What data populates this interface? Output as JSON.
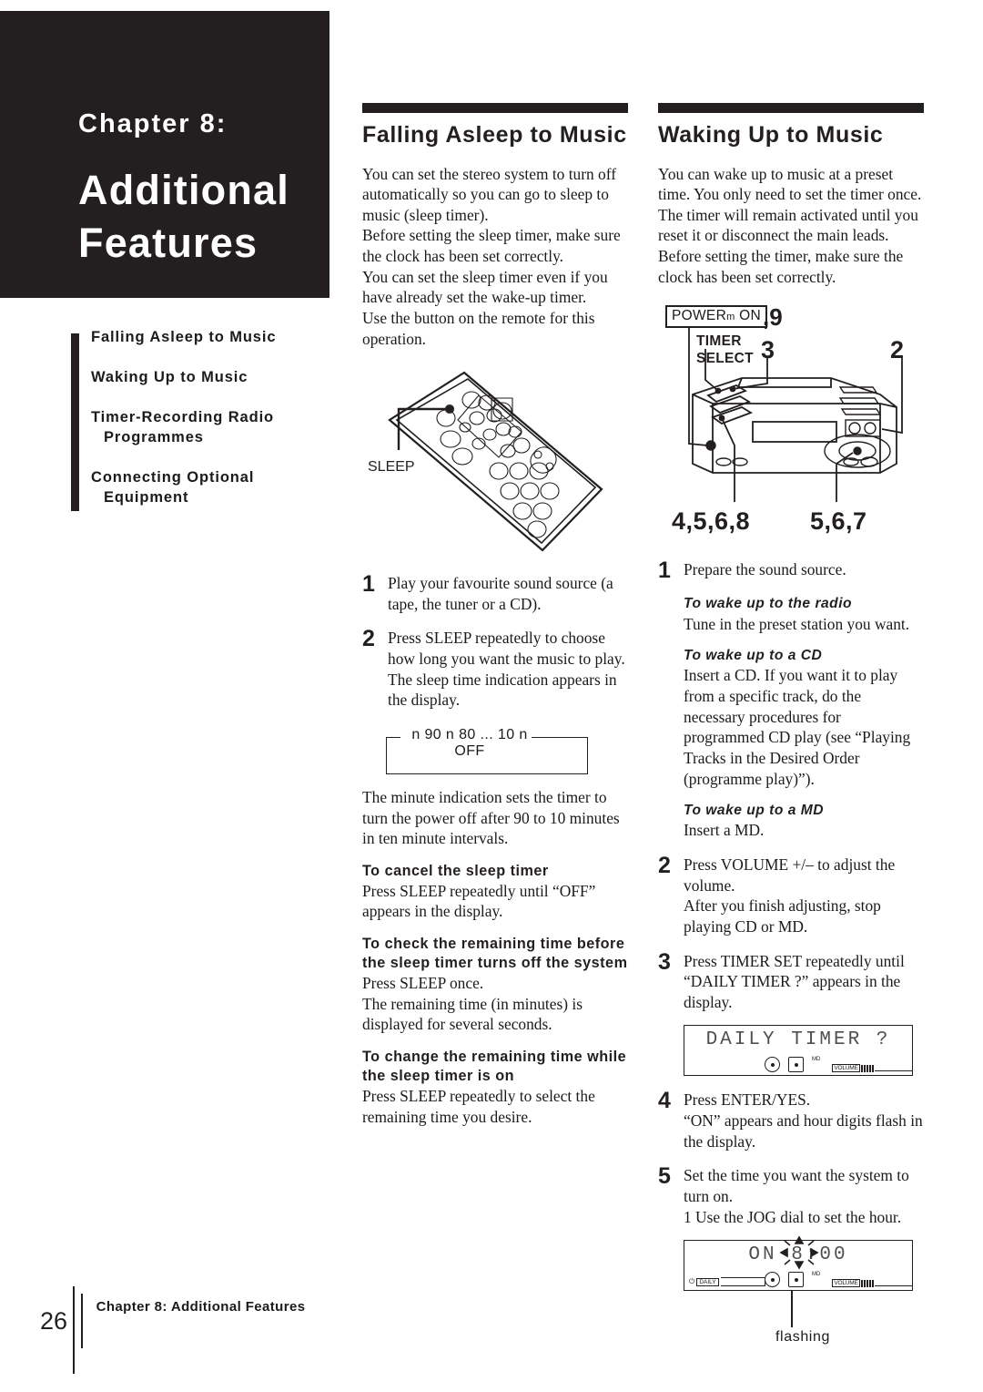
{
  "chapter": {
    "kicker": "Chapter 8:",
    "title": "Additional Features"
  },
  "toc": {
    "items": [
      {
        "line1": "Falling Asleep to Music",
        "line2": ""
      },
      {
        "line1": "Waking Up to Music",
        "line2": ""
      },
      {
        "line1": "Timer-Recording Radio",
        "line2": "Programmes"
      },
      {
        "line1": "Connecting Optional",
        "line2": "Equipment"
      }
    ]
  },
  "middle": {
    "heading": "Falling Asleep to Music",
    "intro": [
      "You can set the stereo system to turn off automatically so you can go to sleep to music (sleep timer).",
      "Before setting the sleep timer, make sure the clock has been set correctly.",
      "You can set the sleep timer even if you have already set the wake-up timer.",
      "Use the button on the remote for this operation."
    ],
    "remote_label": "SLEEP",
    "steps": [
      {
        "num": "1",
        "text": "Play your favourite sound source (a tape, the tuner or a CD)."
      },
      {
        "num": "2",
        "text": "Press SLEEP repeatedly to choose how long you want the music to play."
      }
    ],
    "step2_extra": "The sleep time indication appears in the display.",
    "cycle_text": "n 90 n 80 ... 10 n OFF",
    "after_cycle": "The minute indication sets the timer to turn the power off after 90 to 10 minutes in ten minute intervals.",
    "sections": [
      {
        "heading": "To cancel the sleep timer",
        "body": "Press SLEEP repeatedly until “OFF” appears in  the display."
      },
      {
        "heading": "To check the remaining time before the sleep timer turns off the system",
        "body": "Press SLEEP once.\nThe remaining time (in minutes) is displayed for several seconds."
      },
      {
        "heading": "To change the remaining time while the sleep timer is on",
        "body": "Press SLEEP repeatedly to select the remaining time you desire."
      }
    ]
  },
  "right": {
    "heading": "Waking Up to Music",
    "intro": [
      "You can wake up to music at a preset time. You only need to set the timer once. The timer will remain activated until you reset it or disconnect the main leads.",
      "Before setting the timer, make sure the clock has been set correctly."
    ],
    "diagram": {
      "power_label": "POWER",
      "power_mark": "m",
      "power_on": "ON",
      "power_steps": ",9",
      "timer_select": "TIMER\nSELECT",
      "timer_select_line1": "TIMER",
      "timer_select_line2": "SELECT",
      "callout_3": "3",
      "callout_2": "2",
      "callout_4568": "4,5,6,8",
      "callout_567": "5,6,7"
    },
    "steps": [
      {
        "num": "1",
        "text": "Prepare the sound source."
      },
      {
        "num": "2",
        "text": "Press VOLUME +/– to adjust the volume.\nAfter you finish adjusting, stop playing CD or MD."
      },
      {
        "num": "3",
        "text": "Press TIMER SET repeatedly until “DAILY TIMER ?” appears in the display."
      },
      {
        "num": "4",
        "text": "Press ENTER/YES.\n“ON” appears and hour digits flash in the display."
      },
      {
        "num": "5",
        "text": "Set the time  you want the system to turn on.\n1 Use the JOG dial to set the hour."
      }
    ],
    "sub_sections": [
      {
        "heading": "To wake up to the radio",
        "body": "Tune in the preset station you want."
      },
      {
        "heading": "To wake up to a CD",
        "body": "Insert a CD. If you want it to play from a specific track, do the necessary procedures for programmed CD play (see “Playing Tracks in the Desired Order (programme play)”)."
      },
      {
        "heading": "To wake up to a MD",
        "body": "Insert a MD."
      }
    ],
    "display1": {
      "text": "DAILY TIMER ?",
      "volume_label": "VOLUME"
    },
    "display2": {
      "text": "ON   8:00",
      "on_text": "ON",
      "time_text": "8:00",
      "daily_label": "DAILY",
      "volume_label": "VOLUME",
      "flashing_label": "flashing"
    }
  },
  "footer": {
    "page_number": "26",
    "text": "Chapter 8: Additional Features"
  }
}
